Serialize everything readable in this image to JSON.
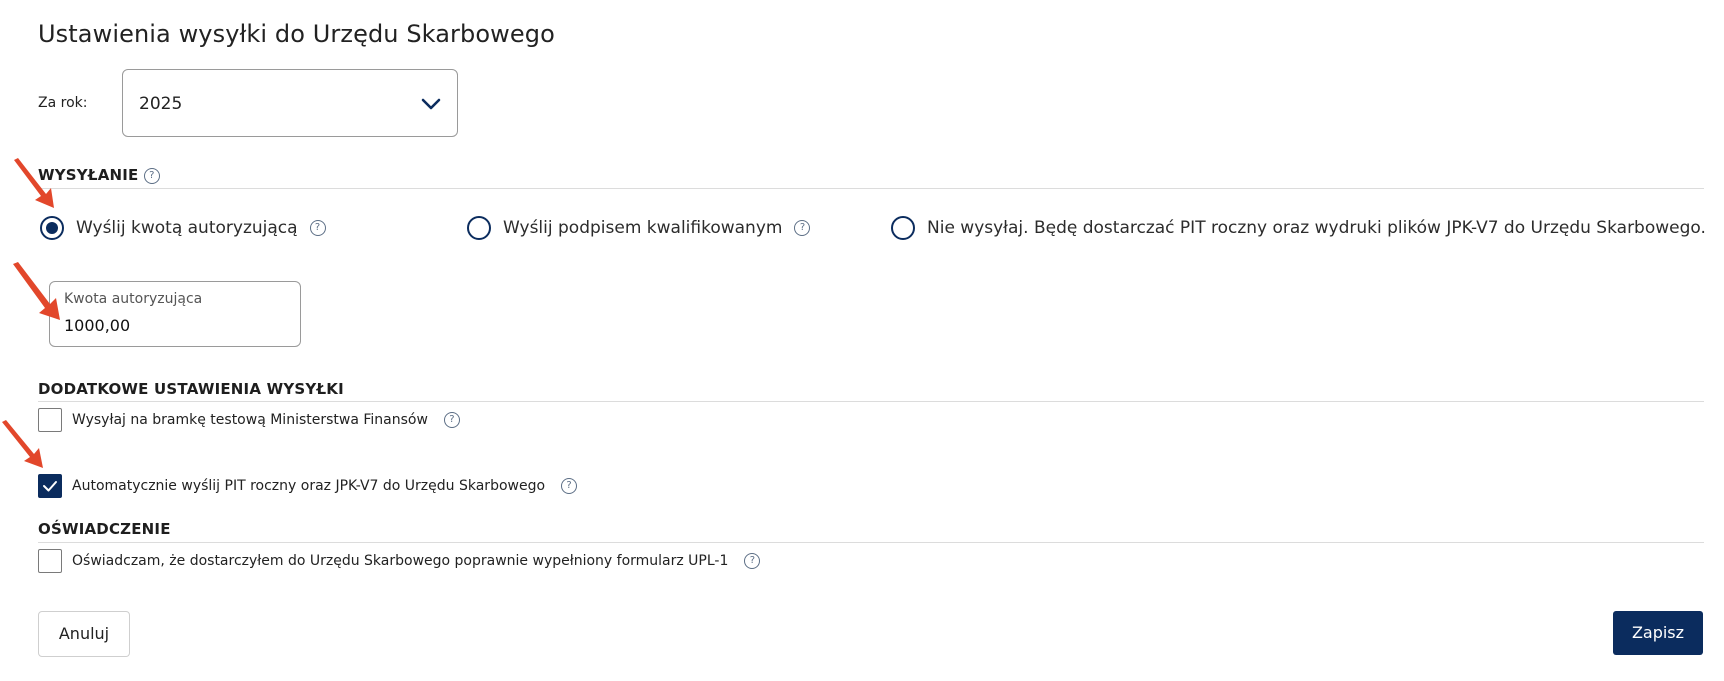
{
  "page": {
    "title": "Ustawienia wysyłki do Urzędu Skarbowego"
  },
  "year": {
    "label": "Za rok:",
    "selected": "2025"
  },
  "sending": {
    "heading": "WYSYŁANIE",
    "help": "?",
    "options": [
      {
        "label": "Wyślij kwotą autoryzującą",
        "selected": true
      },
      {
        "label": "Wyślij podpisem kwalifikowanym",
        "selected": false
      },
      {
        "label": "Nie wysyłaj. Będę dostarczać PIT roczny oraz wydruki plików JPK-V7 do Urzędu Skarbowego.",
        "selected": false
      }
    ],
    "amount_field": {
      "label": "Kwota autoryzująca",
      "value": "1000,00"
    }
  },
  "additional": {
    "heading": "DODATKOWE USTAWIENIA WYSYŁKI",
    "items": [
      {
        "label": "Wysyłaj na bramkę testową Ministerstwa Finansów",
        "checked": false
      },
      {
        "label": "Automatycznie wyślij PIT roczny oraz JPK-V7 do Urzędu Skarbowego",
        "checked": true
      }
    ]
  },
  "declaration": {
    "heading": "OŚWIADCZENIE",
    "items": [
      {
        "label": "Oświadczam, że dostarczyłem do Urzędu Skarbowego poprawnie wypełniony formularz UPL-1",
        "checked": false
      }
    ]
  },
  "actions": {
    "cancel": "Anuluj",
    "save": "Zapisz"
  },
  "colors": {
    "primary": "#0b2c5e",
    "annotation_arrow": "#e2472b"
  }
}
